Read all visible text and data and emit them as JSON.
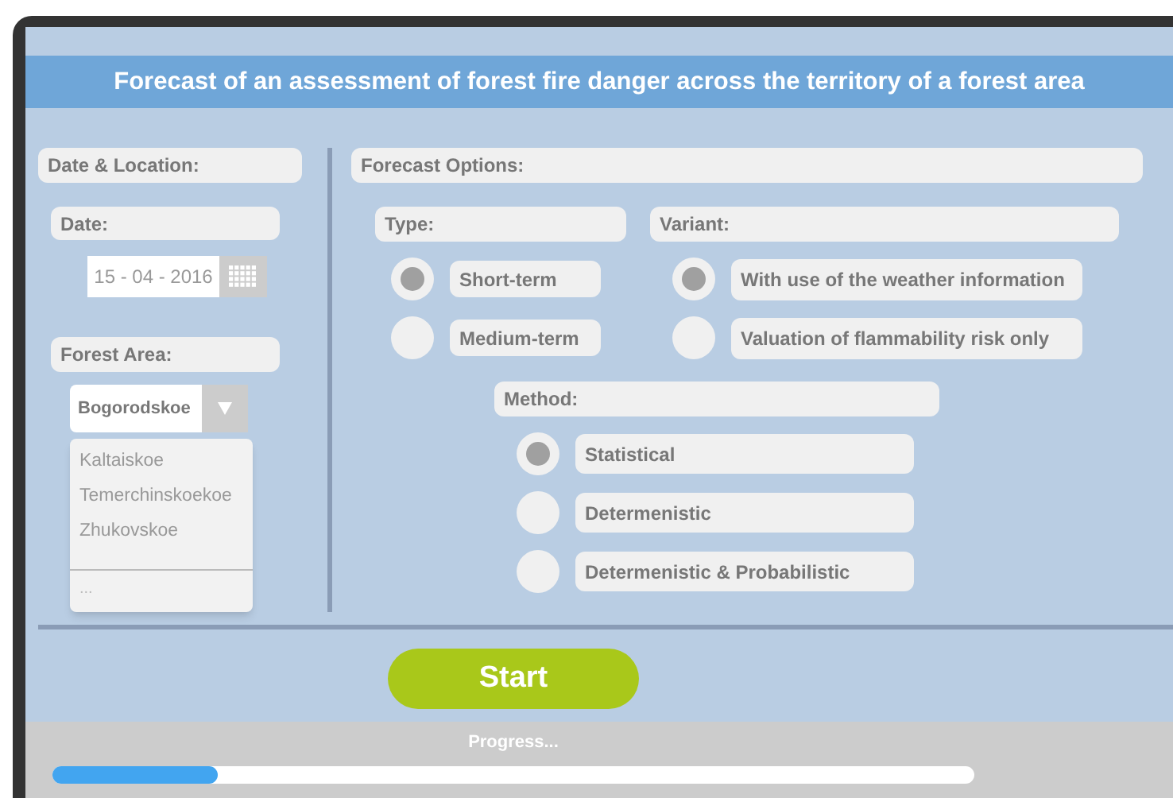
{
  "header": {
    "title": "Forecast of an assessment of forest fire danger across the territory of a forest area"
  },
  "date_location": {
    "title": "Date & Location:",
    "date_label": "Date:",
    "date_value": "15 - 04 - 2016",
    "area_label": "Forest Area:",
    "area_value": "Bogorodskoe",
    "dropdown_open": true,
    "area_options": [
      "Kaltaiskoe",
      "Temerchinskoekoe",
      "Zhukovskoe"
    ],
    "more_option": "..."
  },
  "forecast_options": {
    "title": "Forecast Options:",
    "type": {
      "label": "Type:",
      "options": [
        {
          "label": "Short-term",
          "selected": true
        },
        {
          "label": "Medium-term",
          "selected": false
        }
      ]
    },
    "variant": {
      "label": "Variant:",
      "options": [
        {
          "label": "With use of the weather information",
          "selected": true
        },
        {
          "label": "Valuation of flammability risk only",
          "selected": false
        }
      ]
    },
    "method": {
      "label": "Method:",
      "options": [
        {
          "label": "Statistical",
          "selected": true
        },
        {
          "label": "Determenistic",
          "selected": false
        },
        {
          "label": "Determenistic & Probabilistic",
          "selected": false
        }
      ]
    }
  },
  "start_button": "Start",
  "progress": {
    "label": "Progress...",
    "level": 0.18
  }
}
